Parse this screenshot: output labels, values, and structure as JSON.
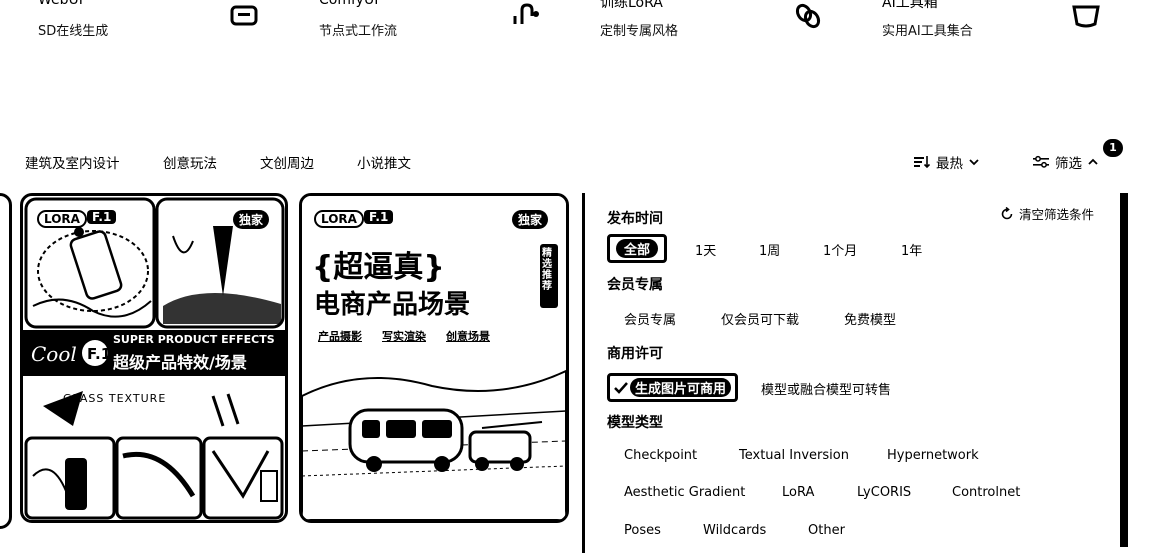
{
  "tools": [
    {
      "title": "WebUI",
      "subtitle": "SD在线生成",
      "icon": "monitor-icon"
    },
    {
      "title": "ComfyUI",
      "subtitle": "节点式工作流",
      "icon": "node-graph-icon"
    },
    {
      "title": "训练LoRA",
      "subtitle": "定制专属风格",
      "icon": "link-icon"
    },
    {
      "title": "AI工具箱",
      "subtitle": "实用AI工具集合",
      "icon": "toolbox-icon"
    }
  ],
  "categories": [
    "建筑及室内设计",
    "创意玩法",
    "文创周边",
    "小说推文"
  ],
  "sort": {
    "label": "最热",
    "icon": "sort-icon"
  },
  "filter": {
    "label": "筛选",
    "badge": "1"
  },
  "cards": [
    {
      "tag_lora": "LORA",
      "tag_model": "F.1",
      "tag_exclusive": "独家",
      "banner_en": "SUPER PRODUCT EFFECTS",
      "banner_cn": "超级产品特效/场景",
      "texture_label": "GLASS TEXTURE"
    },
    {
      "tag_lora": "LORA",
      "tag_model": "F.1",
      "tag_exclusive": "独家",
      "headline": "{超逼真}",
      "subheadline": "电商产品场景",
      "links": [
        "产品摄影",
        "写实渲染",
        "创意场景"
      ],
      "side_label": "精选推荐"
    }
  ],
  "panel": {
    "clear_label": "清空筛选条件",
    "publish_time": {
      "title": "发布时间",
      "options": [
        "全部",
        "1天",
        "1周",
        "1个月",
        "1年"
      ],
      "selected": "全部"
    },
    "member": {
      "title": "会员专属",
      "options": [
        "会员专属",
        "仅会员可下载",
        "免费模型"
      ]
    },
    "license": {
      "title": "商用许可",
      "options": [
        "生成图片可商用",
        "模型或融合模型可转售"
      ],
      "selected": "生成图片可商用"
    },
    "model_type": {
      "title": "模型类型",
      "options": [
        "Checkpoint",
        "Textual Inversion",
        "Hypernetwork",
        "Aesthetic Gradient",
        "LoRA",
        "LyCORIS",
        "Controlnet",
        "Poses",
        "Wildcards",
        "Other"
      ]
    }
  }
}
